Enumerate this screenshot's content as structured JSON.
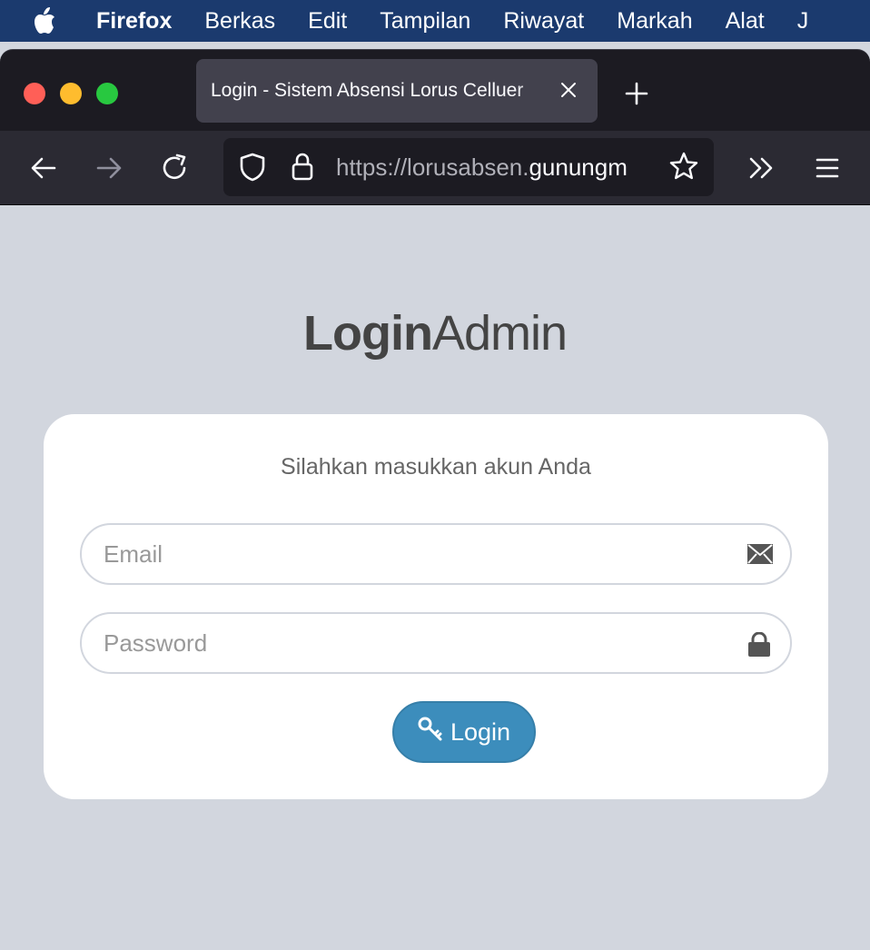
{
  "menubar": {
    "app_name": "Firefox",
    "items": [
      "Berkas",
      "Edit",
      "Tampilan",
      "Riwayat",
      "Markah",
      "Alat",
      "J"
    ]
  },
  "browser": {
    "tab_title": "Login - Sistem Absensi Lorus Celluer",
    "url_scheme": "https://lorusabsen.",
    "url_host": "gunungm"
  },
  "page": {
    "logo_bold": "Login",
    "logo_light": "Admin",
    "message": "Silahkan masukkan akun Anda",
    "email_placeholder": "Email",
    "password_placeholder": "Password",
    "login_label": "Login"
  },
  "icons": {
    "email_field": "envelope-icon",
    "password_field": "lock-icon",
    "login_button": "key-icon"
  },
  "colors": {
    "page_bg": "#d2d6de",
    "button": "#3c8dbc",
    "menubar": "#1b3a6e"
  }
}
